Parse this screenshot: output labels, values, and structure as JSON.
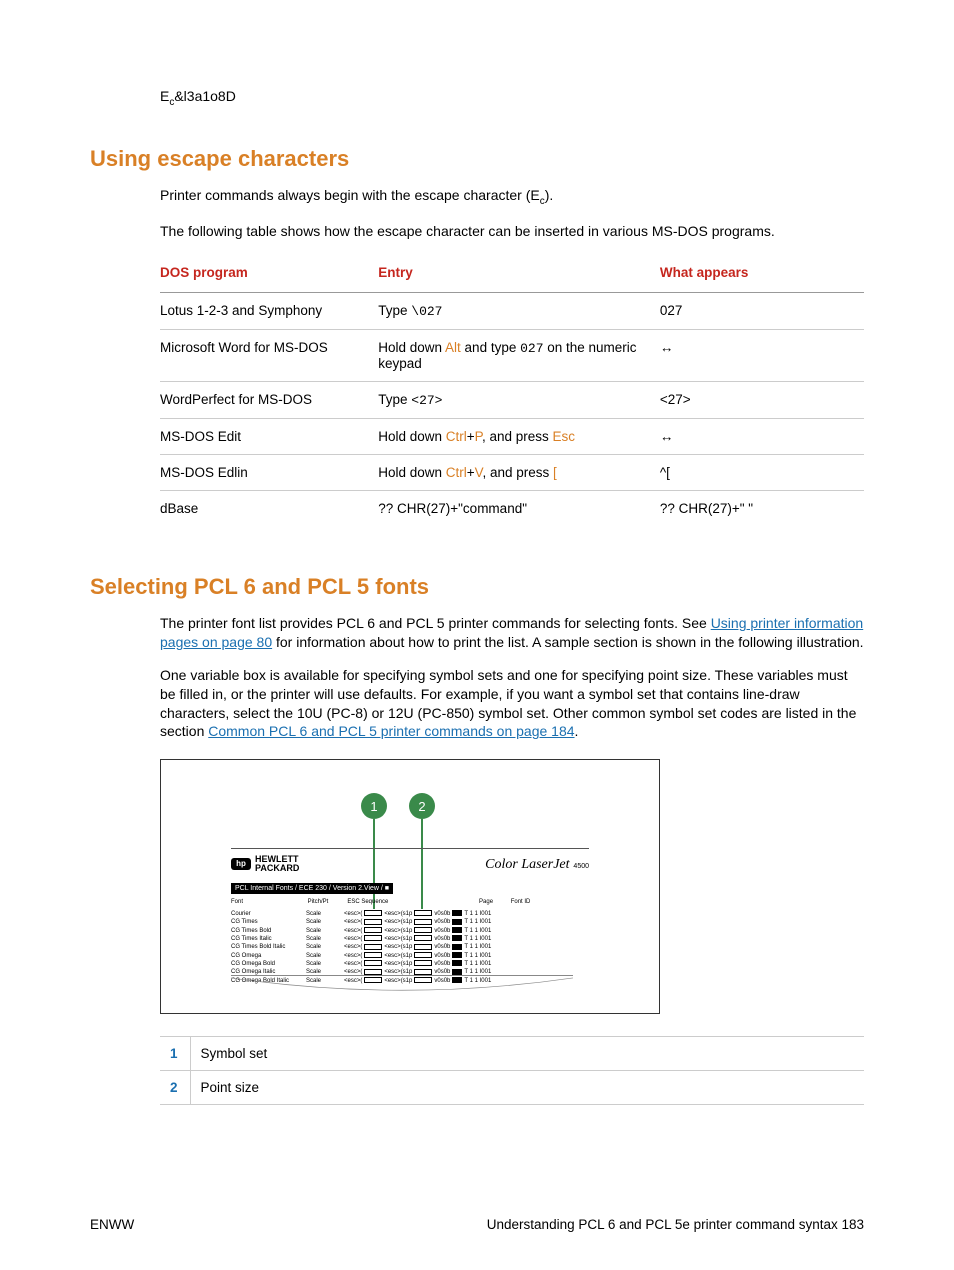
{
  "top_escape": "E",
  "top_escape_sub": "c",
  "top_escape_rest": "&l3a1o8D",
  "section1": {
    "title": "Using escape characters",
    "para1_a": "Printer commands always begin with the escape character (E",
    "para1_sub": "c",
    "para1_b": ").",
    "para2": "The following table shows how the escape character can be inserted in various MS-DOS programs."
  },
  "dostable": {
    "headers": [
      "DOS program",
      "Entry",
      "What appears"
    ],
    "rows": [
      {
        "program": "Lotus 1-2-3 and Symphony",
        "entry_parts": [
          {
            "t": "Type ",
            "k": false,
            "m": false
          },
          {
            "t": "\\027",
            "k": false,
            "m": true
          }
        ],
        "appears": "027"
      },
      {
        "program": "Microsoft Word for MS-DOS",
        "entry_parts": [
          {
            "t": "Hold down ",
            "k": false,
            "m": false
          },
          {
            "t": "Alt",
            "k": true,
            "m": false
          },
          {
            "t": " and type ",
            "k": false,
            "m": false
          },
          {
            "t": "027",
            "k": false,
            "m": true
          },
          {
            "t": " on the numeric keypad",
            "k": false,
            "m": false
          }
        ],
        "appears": "↔"
      },
      {
        "program": "WordPerfect for MS-DOS",
        "entry_parts": [
          {
            "t": "Type ",
            "k": false,
            "m": false
          },
          {
            "t": "<27>",
            "k": false,
            "m": true
          }
        ],
        "appears": "<27>"
      },
      {
        "program": "MS-DOS Edit",
        "entry_parts": [
          {
            "t": "Hold down ",
            "k": false,
            "m": false
          },
          {
            "t": "Ctrl",
            "k": true,
            "m": false
          },
          {
            "t": "+",
            "k": false,
            "m": false
          },
          {
            "t": "P",
            "k": true,
            "m": false
          },
          {
            "t": ", and press ",
            "k": false,
            "m": false
          },
          {
            "t": "Esc",
            "k": true,
            "m": false
          }
        ],
        "appears": "↔"
      },
      {
        "program": "MS-DOS Edlin",
        "entry_parts": [
          {
            "t": "Hold down ",
            "k": false,
            "m": false
          },
          {
            "t": "Ctrl",
            "k": true,
            "m": false
          },
          {
            "t": "+",
            "k": false,
            "m": false
          },
          {
            "t": "V",
            "k": true,
            "m": false
          },
          {
            "t": ", and press ",
            "k": false,
            "m": false
          },
          {
            "t": "[",
            "k": true,
            "m": false
          }
        ],
        "appears": "^["
      },
      {
        "program": "dBase",
        "entry_parts": [
          {
            "t": "?? CHR(27)+\"command\"",
            "k": false,
            "m": false
          }
        ],
        "appears": "?? CHR(27)+\" \""
      }
    ]
  },
  "section2": {
    "title": "Selecting PCL 6 and PCL 5 fonts",
    "p1_a": "The printer font list provides PCL 6 and PCL 5 printer commands for selecting fonts. See ",
    "p1_link": "Using printer information pages on page 80",
    "p1_b": " for information about how to print the list. A sample section is shown in the following illustration.",
    "p2_a": "One variable box is available for specifying symbol sets and one for specifying point size. These variables must be filled in, or the printer will use defaults. For example, if you want a symbol set that contains line-draw characters, select the 10U (PC-8) or 12U (PC-850) symbol set. Other common symbol set codes are listed in the section ",
    "p2_link": "Common PCL 6 and PCL 5 printer commands on page 184",
    "p2_b": "."
  },
  "illustration": {
    "callouts": [
      "1",
      "2"
    ],
    "hp_logo_text1": "HEWLETT",
    "hp_logo_text2": "PACKARD",
    "hp_logo_sym": "hp",
    "brand": "Color LaserJet",
    "brand_suffix": "4500",
    "bar": "PCL Internal Fonts / ECE 230 / Version 2.View / ■",
    "hdr": {
      "c0": "Font",
      "c1": "Pitch/Pt",
      "c2": "ESC Sequence",
      "c3": "Page",
      "c4": "Font ID"
    },
    "rows": [
      {
        "a": "Courier",
        "b": "Scale"
      },
      {
        "a": "CG Times",
        "b": "Scale"
      },
      {
        "a": "CG Times Bold",
        "b": "Scale"
      },
      {
        "a": "CG Times Italic",
        "b": "Scale"
      },
      {
        "a": "CG Times Bold Italic",
        "b": "Scale"
      },
      {
        "a": "CG Omega",
        "b": "Scale"
      },
      {
        "a": "CG Omega Bold",
        "b": "Scale"
      },
      {
        "a": "CG Omega Italic",
        "b": "Scale"
      },
      {
        "a": "CG Omega Bold Italic",
        "b": "Scale"
      }
    ]
  },
  "legend": [
    {
      "n": "1",
      "t": "Symbol set"
    },
    {
      "n": "2",
      "t": "Point size"
    }
  ],
  "footer": {
    "left": "ENWW",
    "right": "Understanding PCL 6 and PCL 5e printer command syntax   183"
  }
}
